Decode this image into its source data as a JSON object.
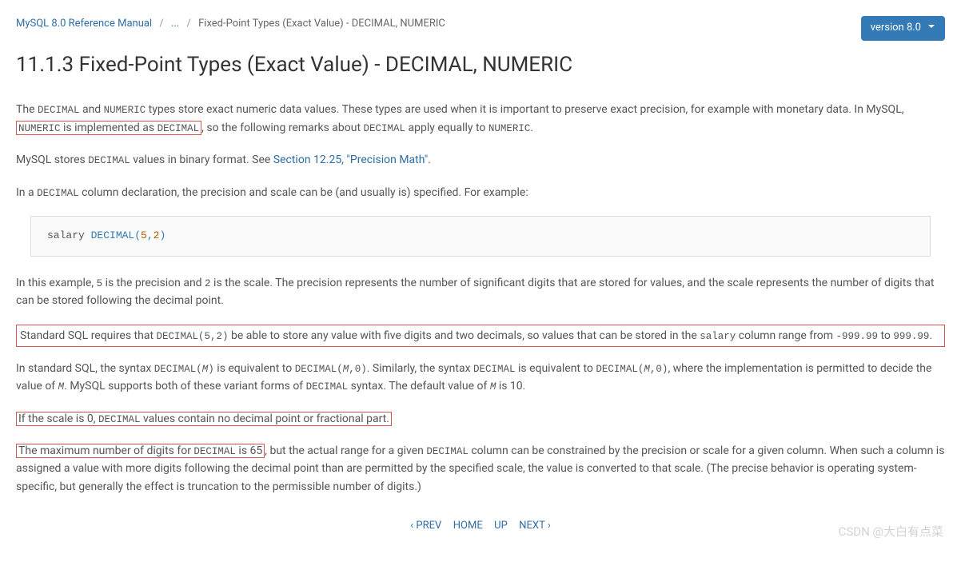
{
  "breadcrumb": {
    "root": "MySQL 8.0 Reference Manual",
    "ellipsis": "...",
    "current": "Fixed-Point Types (Exact Value) - DECIMAL, NUMERIC"
  },
  "version": {
    "label": "version 8.0"
  },
  "title": "11.1.3 Fixed-Point Types (Exact Value) - DECIMAL, NUMERIC",
  "p1": {
    "t1": "The ",
    "c1": "DECIMAL",
    "t2": " and ",
    "c2": "NUMERIC",
    "t3": " types store exact numeric data values. These types are used when it is important to preserve exact precision, for example with monetary data. In MySQL, ",
    "hl1_a": "NUMERIC",
    "hl1_b": " is implemented as ",
    "hl1_c": "DECIMAL",
    "t4": ", so the following remarks about ",
    "c3": "DECIMAL",
    "t5": " apply equally to ",
    "c4": "NUMERIC",
    "t6": "."
  },
  "p2": {
    "t1": "MySQL stores ",
    "c1": "DECIMAL",
    "t2": " values in binary format. See ",
    "link": "Section 12.25, \"Precision Math\"",
    "t3": "."
  },
  "p3": {
    "t1": "In a ",
    "c1": "DECIMAL",
    "t2": " column declaration, the precision and scale can be (and usually is) specified. For example:"
  },
  "codeblock": {
    "ident": "salary ",
    "kw": "DECIMAL",
    "paren_open": "(",
    "n1": "5",
    "comma": ",",
    "n2": "2",
    "paren_close": ")"
  },
  "p4": {
    "t1": "In this example, ",
    "c1": "5",
    "t2": " is the precision and ",
    "c2": "2",
    "t3": " is the scale. The precision represents the number of significant digits that are stored for values, and the scale represents the number of digits that can be stored following the decimal point."
  },
  "p5": {
    "t1": "Standard SQL requires that ",
    "c1": "DECIMAL(5,2)",
    "t2": " be able to store any value with five digits and two decimals, so values that can be stored in the ",
    "c2": "salary",
    "t3": " column range from ",
    "c3": "-999.99",
    "t4": " to ",
    "c4": "999.99",
    "t5": "."
  },
  "p6": {
    "t1": "In standard SQL, the syntax ",
    "c1": "DECIMAL(",
    "i1": "M",
    "c1b": ")",
    "t2": " is equivalent to ",
    "c2": "DECIMAL(",
    "i2": "M",
    "c2b": ",0)",
    "t3": ". Similarly, the syntax ",
    "c3": "DECIMAL",
    "t4": " is equivalent to ",
    "c4": "DECIMAL(",
    "i4": "M",
    "c4b": ",0)",
    "t5": ", where the implementation is permitted to decide the value of ",
    "i5": "M",
    "t6": ". MySQL supports both of these variant forms of ",
    "c5": "DECIMAL",
    "t7": " syntax. The default value of ",
    "i6": "M",
    "t8": " is 10."
  },
  "p7": {
    "t1": "If the scale is 0, ",
    "c1": "DECIMAL",
    "t2": " values contain no decimal point or fractional part."
  },
  "p8": {
    "hl_a": "The maximum number of digits for ",
    "hl_c": "DECIMAL",
    "hl_b": " is 65",
    "t2": ", but the actual range for a given ",
    "c1": "DECIMAL",
    "t3": " column can be constrained by the precision or scale for a given column. When such a column is assigned a value with more digits following the decimal point than are permitted by the specified scale, the value is converted to that scale. (The precise behavior is operating system-specific, but generally the effect is truncation to the permissible number of digits.)"
  },
  "footer": {
    "prev": "PREV",
    "home": "HOME",
    "up": "UP",
    "next": "NEXT"
  },
  "watermark": "CSDN @大白有点菜"
}
